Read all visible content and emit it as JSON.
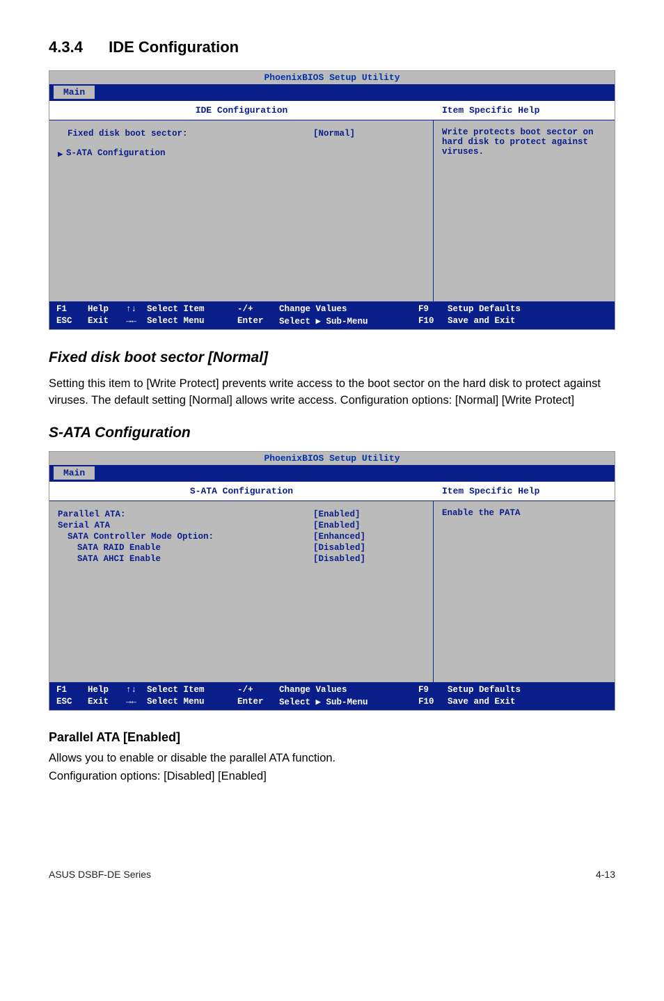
{
  "section": {
    "num": "4.3.4",
    "title": "IDE Configuration"
  },
  "bios1": {
    "utility_title": "PhoenixBIOS Setup Utility",
    "tab": "Main",
    "panel_title": "IDE Configuration",
    "help_title": "Item Specific Help",
    "help_text": "Write protects boot sector on hard disk to protect against viruses.",
    "rows": [
      {
        "label": "Fixed disk boot sector:",
        "value": "[Normal]"
      },
      {
        "label": "S-ATA Configuration",
        "value": "",
        "arrow": true
      }
    ]
  },
  "footkeys": {
    "f1": "F1",
    "help": "Help",
    "arrows1": "↑↓",
    "selectitem": "Select Item",
    "plusminus": "-/+",
    "change": "Change Values",
    "f9": "F9",
    "setup": "Setup Defaults",
    "esc": "ESC",
    "exit": "Exit",
    "arrows2": "→←",
    "selectmenu": "Select Menu",
    "enter": "Enter",
    "selectsub": "Select ▶ Sub-Menu",
    "f10": "F10",
    "save": "Save and Exit"
  },
  "sub1": {
    "title": "Fixed disk boot sector [Normal]",
    "text": "Setting this item to [Write Protect] prevents write access to the boot sector on the hard disk to protect against viruses. The default setting [Normal] allows write access. Configuration options: [Normal] [Write Protect]"
  },
  "sub2": {
    "title": "S-ATA Configuration"
  },
  "bios2": {
    "utility_title": "PhoenixBIOS Setup Utility",
    "tab": "Main",
    "panel_title": "S-ATA Configuration",
    "help_title": "Item Specific Help",
    "help_text": "Enable the PATA",
    "rows": [
      {
        "label": "Parallel ATA:",
        "value": "[Enabled]"
      },
      {
        "label": "Serial ATA",
        "value": "[Enabled]"
      },
      {
        "label": "SATA Controller Mode Option:",
        "value": "[Enhanced]",
        "indent": 1
      },
      {
        "label": "SATA RAID Enable",
        "value": "[Disabled]",
        "indent": 2
      },
      {
        "label": "SATA AHCI Enable",
        "value": "[Disabled]",
        "indent": 2
      }
    ]
  },
  "h3": {
    "title": "Parallel ATA [Enabled]",
    "text1": "Allows you to enable or disable the parallel ATA function.",
    "text2": "Configuration options: [Disabled] [Enabled]"
  },
  "footer": {
    "left": "ASUS DSBF-DE Series",
    "right": "4-13"
  }
}
